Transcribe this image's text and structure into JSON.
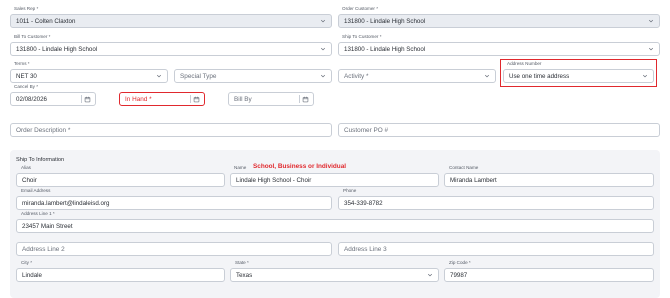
{
  "sales_rep": {
    "label": "Sales Rep *",
    "value": "1011 - Colten Claxton"
  },
  "order_customer": {
    "label": "Order Customer *",
    "value": "131800 - Lindale High School"
  },
  "bill_to_customer": {
    "label": "Bill To Customer *",
    "value": "131800 - Lindale High School"
  },
  "ship_to_customer": {
    "label": "Ship To Customer *",
    "value": "131800 - Lindale High School"
  },
  "terms": {
    "label": "Terms *",
    "value": "NET 30"
  },
  "special_type": {
    "placeholder": "Special Type"
  },
  "activity": {
    "placeholder": "Activity *"
  },
  "address_number": {
    "label": "Address Number",
    "value": "Use one time address"
  },
  "cancel_by": {
    "label": "Cancel By *",
    "value": "02/08/2026"
  },
  "in_hand": {
    "placeholder": "In Hand *"
  },
  "bill_by": {
    "placeholder": "Bill By"
  },
  "order_description": {
    "placeholder": "Order Description *"
  },
  "customer_po": {
    "placeholder": "Customer PO #"
  },
  "ship_to": {
    "title": "Ship To Information",
    "alias": {
      "label": "Alias",
      "value": "Choir"
    },
    "name": {
      "label": "Name",
      "value": "Lindale High School - Choir",
      "hint": "School, Business or Individual"
    },
    "contact_name": {
      "label": "Contact Name",
      "value": "Miranda Lambert"
    },
    "email": {
      "label": "Email Address",
      "value": "miranda.lambert@lindaleisd.org"
    },
    "phone": {
      "label": "Phone",
      "value": "354-339-8782"
    },
    "address1": {
      "label": "Address Line 1 *",
      "value": "23457 Main Street"
    },
    "address2": {
      "placeholder": "Address Line 2"
    },
    "address3": {
      "placeholder": "Address Line 3"
    },
    "city": {
      "label": "City *",
      "value": "Lindale"
    },
    "state": {
      "label": "State *",
      "value": "Texas"
    },
    "zip": {
      "label": "Zip Code *",
      "value": "79987"
    }
  },
  "colors": {
    "highlight": "#e0292e",
    "field_border": "#c9ced6",
    "disabled_bg": "#e9ecf1",
    "panel_bg": "#f3f4f7"
  },
  "icons": [
    "chevron-down-icon",
    "calendar-icon"
  ]
}
